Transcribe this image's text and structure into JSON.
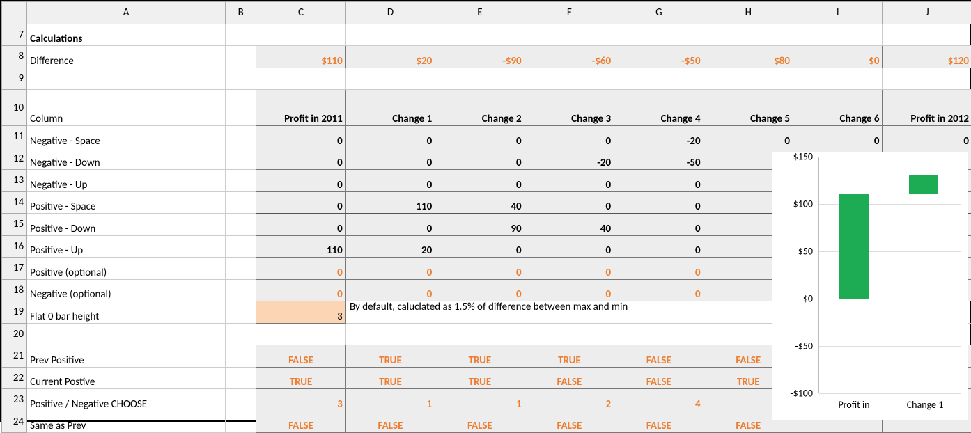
{
  "columns": [
    "A",
    "B",
    "C",
    "D",
    "E",
    "F",
    "G",
    "H",
    "I",
    "J"
  ],
  "rows": [
    7,
    8,
    9,
    10,
    11,
    12,
    13,
    14,
    15,
    16,
    17,
    18,
    19,
    20,
    21,
    22,
    23,
    24
  ],
  "labels": {
    "calculations": "Calculations",
    "difference": "Difference",
    "column": "Column",
    "neg_space": "Negative - Space",
    "neg_down": "Negative - Down",
    "neg_up": "Negative - Up",
    "pos_space": "Positive - Space",
    "pos_down": "Positive - Down",
    "pos_up": "Positive - Up",
    "pos_opt": "Positive (optional)",
    "neg_opt": "Negative (optional)",
    "flat0": "Flat 0 bar height",
    "prev_pos": "Prev Positive",
    "cur_pos": "Current Postive",
    "choose": "Positive / Negative CHOOSE",
    "same_prev": "Same as Prev",
    "flat0_note": "By default, caluclated as 1.5% of difference between max and min"
  },
  "row8": [
    "$110",
    "$20",
    "-$90",
    "-$60",
    "-$50",
    "$80",
    "$0",
    "$120"
  ],
  "row10": [
    "Profit in 2011",
    "Change 1",
    "Change 2",
    "Change 3",
    "Change 4",
    "Change 5",
    "Change 6",
    "Profit in 2012"
  ],
  "row11": [
    "0",
    "0",
    "0",
    "0",
    "-20",
    "0",
    "0",
    "0"
  ],
  "row12": [
    "0",
    "0",
    "0",
    "-20",
    "-50"
  ],
  "row13": [
    "0",
    "0",
    "0",
    "0",
    "0",
    "-"
  ],
  "row14": [
    "0",
    "110",
    "40",
    "0",
    "0"
  ],
  "row15": [
    "0",
    "0",
    "90",
    "40",
    "0"
  ],
  "row16": [
    "110",
    "20",
    "0",
    "0",
    "0"
  ],
  "row17": [
    "0",
    "0",
    "0",
    "0",
    "0"
  ],
  "row18": [
    "0",
    "0",
    "0",
    "0",
    "0"
  ],
  "row19_c": "3",
  "row21": [
    "FALSE",
    "TRUE",
    "TRUE",
    "TRUE",
    "FALSE",
    "FALSE"
  ],
  "row22": [
    "TRUE",
    "TRUE",
    "TRUE",
    "FALSE",
    "FALSE",
    "TRUE"
  ],
  "row23": [
    "3",
    "1",
    "1",
    "2",
    "4"
  ],
  "row24": [
    "FALSE",
    "FALSE",
    "FALSE",
    "FALSE",
    "FALSE",
    "FALSE"
  ],
  "chart_data": {
    "type": "bar",
    "categories": [
      "Profit in",
      "Change 1"
    ],
    "values": [
      110,
      130
    ],
    "float_base": [
      0,
      110
    ],
    "ylim": [
      -100,
      150
    ],
    "yticks": [
      "$150",
      "$100",
      "$50",
      "$0",
      "-$50",
      "-$100"
    ],
    "ytick_vals": [
      150,
      100,
      50,
      0,
      -50,
      -100
    ]
  }
}
